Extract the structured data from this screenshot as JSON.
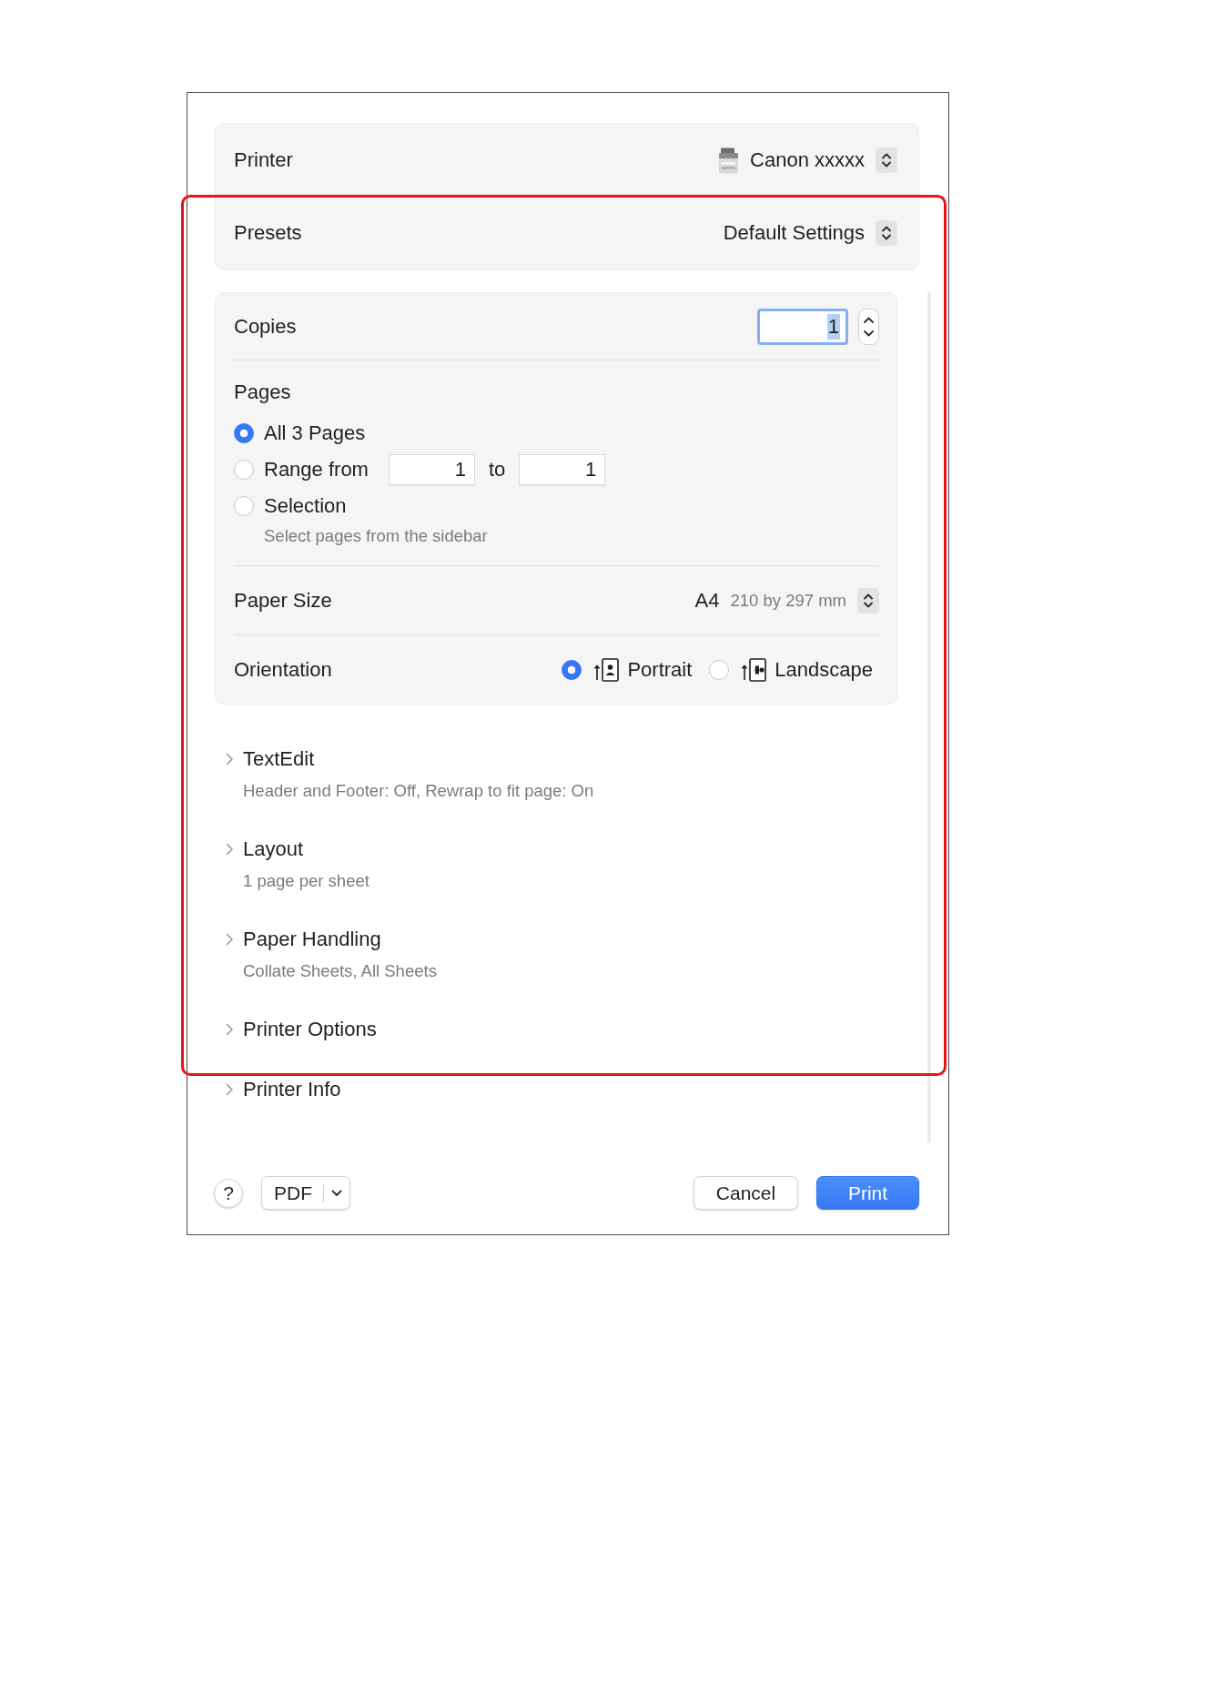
{
  "printer": {
    "label": "Printer",
    "value": "Canon xxxxx"
  },
  "presets": {
    "label": "Presets",
    "value": "Default Settings"
  },
  "copies": {
    "label": "Copies",
    "value": "1",
    "focused": true
  },
  "pages": {
    "label": "Pages",
    "options": [
      {
        "kind": "all",
        "label": "All 3 Pages",
        "selected": true
      },
      {
        "kind": "range",
        "label": "Range from",
        "from": "1",
        "to_label": "to",
        "to": "1",
        "selected": false
      },
      {
        "kind": "selection",
        "label": "Selection",
        "hint": "Select pages from the sidebar",
        "selected": false
      }
    ]
  },
  "paper_size": {
    "label": "Paper Size",
    "value": "A4",
    "dimensions": "210 by 297 mm"
  },
  "orientation": {
    "label": "Orientation",
    "options": [
      {
        "kind": "portrait",
        "label": "Portrait",
        "selected": true
      },
      {
        "kind": "landscape",
        "label": "Landscape",
        "selected": false
      }
    ]
  },
  "sections": [
    {
      "title": "TextEdit",
      "summary": "Header and Footer: Off, Rewrap to fit page: On",
      "expanded": false
    },
    {
      "title": "Layout",
      "summary": "1 page per sheet",
      "expanded": false
    },
    {
      "title": "Paper Handling",
      "summary": "Collate Sheets, All Sheets",
      "expanded": false
    },
    {
      "title": "Printer Options",
      "expanded": false
    },
    {
      "title": "Printer Info",
      "expanded": false
    }
  ],
  "footer": {
    "help": "?",
    "pdf": "PDF",
    "buttons": [
      {
        "kind": "cancel",
        "label": "Cancel"
      },
      {
        "kind": "confirm",
        "label": "Print"
      }
    ]
  }
}
